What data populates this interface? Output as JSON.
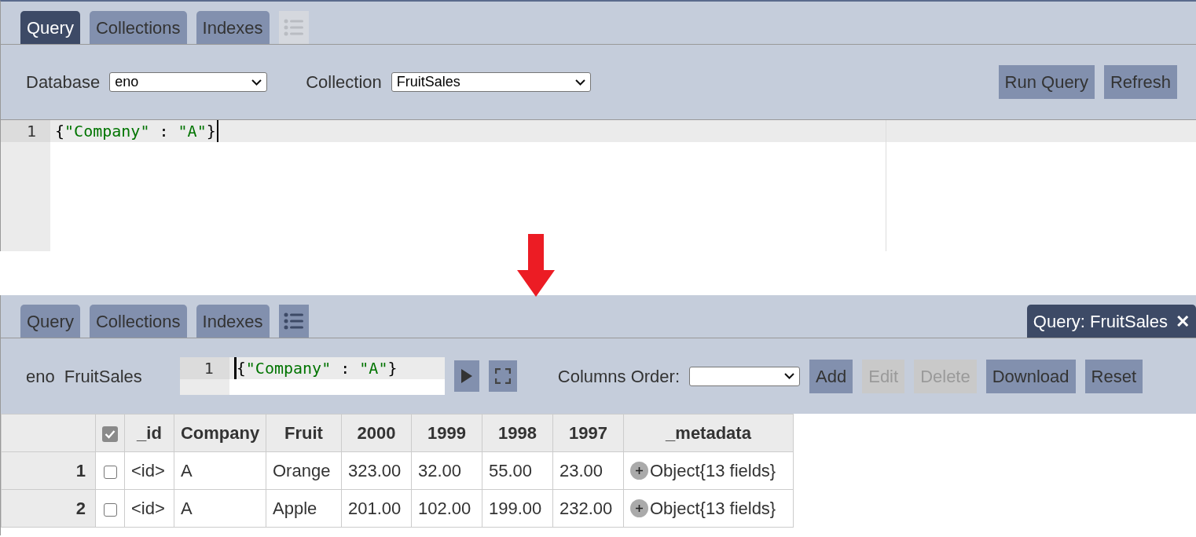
{
  "before": {
    "tabs": [
      {
        "label": "Query",
        "selected": true
      },
      {
        "label": "Collections",
        "selected": false
      },
      {
        "label": "Indexes",
        "selected": false
      }
    ],
    "list_button": {
      "disabled": true
    },
    "database": {
      "label": "Database",
      "value": "eno"
    },
    "collection": {
      "label": "Collection",
      "value": "FruitSales"
    },
    "buttons": [
      {
        "label": "Run Query",
        "disabled": false
      },
      {
        "label": "Refresh",
        "disabled": false
      }
    ],
    "editor": {
      "line_number": "1",
      "tokens": [
        {
          "kind": "punct",
          "text": "{"
        },
        {
          "kind": "string",
          "text": "\"Company\""
        },
        {
          "kind": "punct",
          "text": " : "
        },
        {
          "kind": "string",
          "text": "\"A\""
        },
        {
          "kind": "punct",
          "text": "}"
        }
      ]
    }
  },
  "after": {
    "tabs": [
      {
        "label": "Query",
        "selected": false
      },
      {
        "label": "Collections",
        "selected": false
      },
      {
        "label": "Indexes",
        "selected": false
      }
    ],
    "list_button": {
      "disabled": false
    },
    "result_tab": {
      "label": "Query: FruitSales",
      "close": "✕",
      "selected": true
    },
    "database": "eno",
    "collection": "FruitSales",
    "editor": {
      "line_number": "1",
      "tokens": [
        {
          "kind": "punct",
          "text": "{"
        },
        {
          "kind": "string",
          "text": "\"Company\""
        },
        {
          "kind": "punct",
          "text": " : "
        },
        {
          "kind": "string",
          "text": "\"A\""
        },
        {
          "kind": "punct",
          "text": "}"
        }
      ]
    },
    "columns_order": {
      "label": "Columns Order:"
    },
    "buttons": [
      {
        "label": "Add",
        "disabled": false
      },
      {
        "label": "Edit",
        "disabled": true
      },
      {
        "label": "Delete",
        "disabled": true
      },
      {
        "label": "Download",
        "disabled": false
      },
      {
        "label": "Reset",
        "disabled": false
      }
    ],
    "table": {
      "select_all": {
        "checked": true
      },
      "columns": [
        "_id",
        "Company",
        "Fruit",
        "2000",
        "1999",
        "1998",
        "1997",
        "_metadata"
      ],
      "rows": [
        {
          "number": "1",
          "checked": false,
          "cells": [
            "<id>",
            "A",
            "Orange",
            "323.00",
            "32.00",
            "55.00",
            "23.00"
          ],
          "metadata": "Object{13 fields}"
        },
        {
          "number": "2",
          "checked": false,
          "cells": [
            "<id>",
            "A",
            "Apple",
            "201.00",
            "102.00",
            "199.00",
            "232.00"
          ],
          "metadata": "Object{13 fields}"
        }
      ]
    }
  }
}
